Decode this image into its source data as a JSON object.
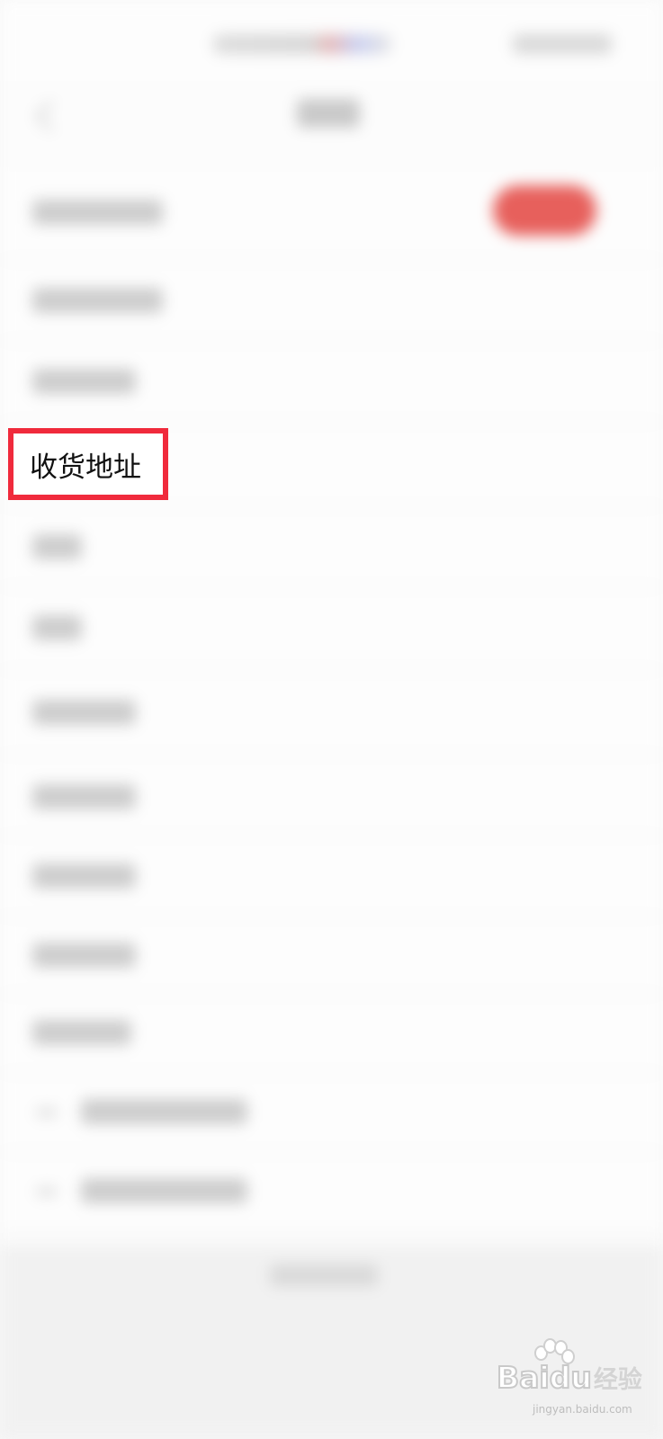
{
  "highlighted_item": {
    "label": "收货地址"
  },
  "watermark": {
    "brand_en": "Bai",
    "brand_en_2": "du",
    "brand_cn": "经验",
    "url": "jingyan.baidu.com"
  },
  "colors": {
    "highlight_border": "#f02a3c",
    "accent_button": "#e7605c",
    "background": "#f8f8f8"
  },
  "icons": [
    "back-arrow-icon",
    "paw-icon"
  ]
}
